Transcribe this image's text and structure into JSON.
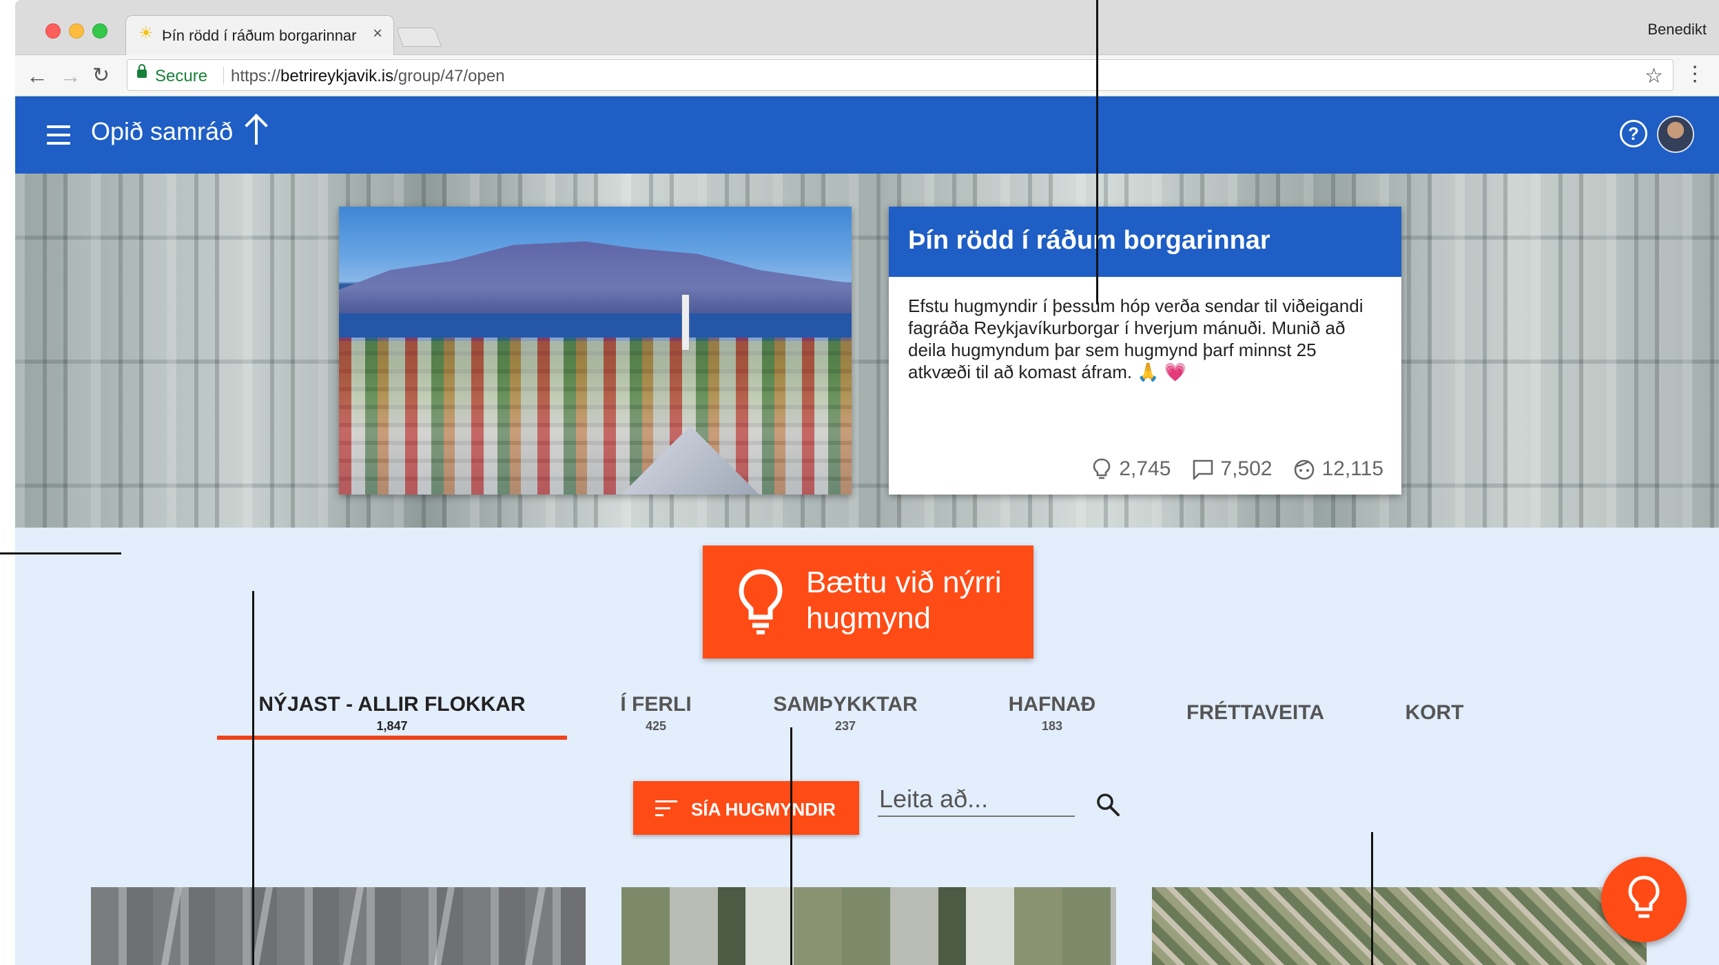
{
  "browser": {
    "tab_title": "Þín rödd í ráðum borgarinnar",
    "tab_favicon": "☀",
    "tab_close": "×",
    "profile_name": "Benedikt",
    "nav_back": "←",
    "nav_forward": "→",
    "nav_reload": "↻",
    "secure_label": "Secure",
    "url_scheme": "https://",
    "url_host": "betrireykjavik.is",
    "url_path": "/group/47/open",
    "bookmark_star": "☆",
    "menu_dots": "⋮"
  },
  "appbar": {
    "title": "Opið samráð",
    "color": "#1e5ec5"
  },
  "group": {
    "title": "Þín rödd í ráðum borgarinnar",
    "description": "Efstu hugmyndir í þessum hóp verða sendar til viðeigandi fagráða Reykjavíkurborgar í hverjum mánuði. Munið að deila hugmyndum þar sem hugmynd þarf minnst 25 atkvæði til að komast áfram. 🙏 💗",
    "stats": {
      "ideas": "2,745",
      "comments": "7,502",
      "users": "12,115"
    }
  },
  "main": {
    "new_idea_label": "Bættu við nýrri hugmynd",
    "accent_color": "#ff4b16",
    "background": "#e3eefc",
    "tabs": [
      {
        "label": "NÝJAST - ALLIR FLOKKAR",
        "count": "1,847",
        "active": true
      },
      {
        "label": "Í FERLI",
        "count": "425",
        "active": false
      },
      {
        "label": "SAMÞYKKTAR",
        "count": "237",
        "active": false
      },
      {
        "label": "HAFNAÐ",
        "count": "183",
        "active": false
      },
      {
        "label": "FRÉTTAVEITA",
        "count": "",
        "active": false
      },
      {
        "label": "KORT",
        "count": "",
        "active": false
      }
    ],
    "filter_label": "SÍA HUGMYNDIR",
    "search_placeholder": "Leita að..."
  },
  "icons": {
    "menu": "hamburger-icon",
    "up": "arrow-up-icon",
    "help": "help-circle-icon",
    "idea": "lightbulb-icon",
    "comments": "comment-icon",
    "users": "face-icon",
    "filter": "filter-list-icon",
    "search": "search-icon"
  }
}
